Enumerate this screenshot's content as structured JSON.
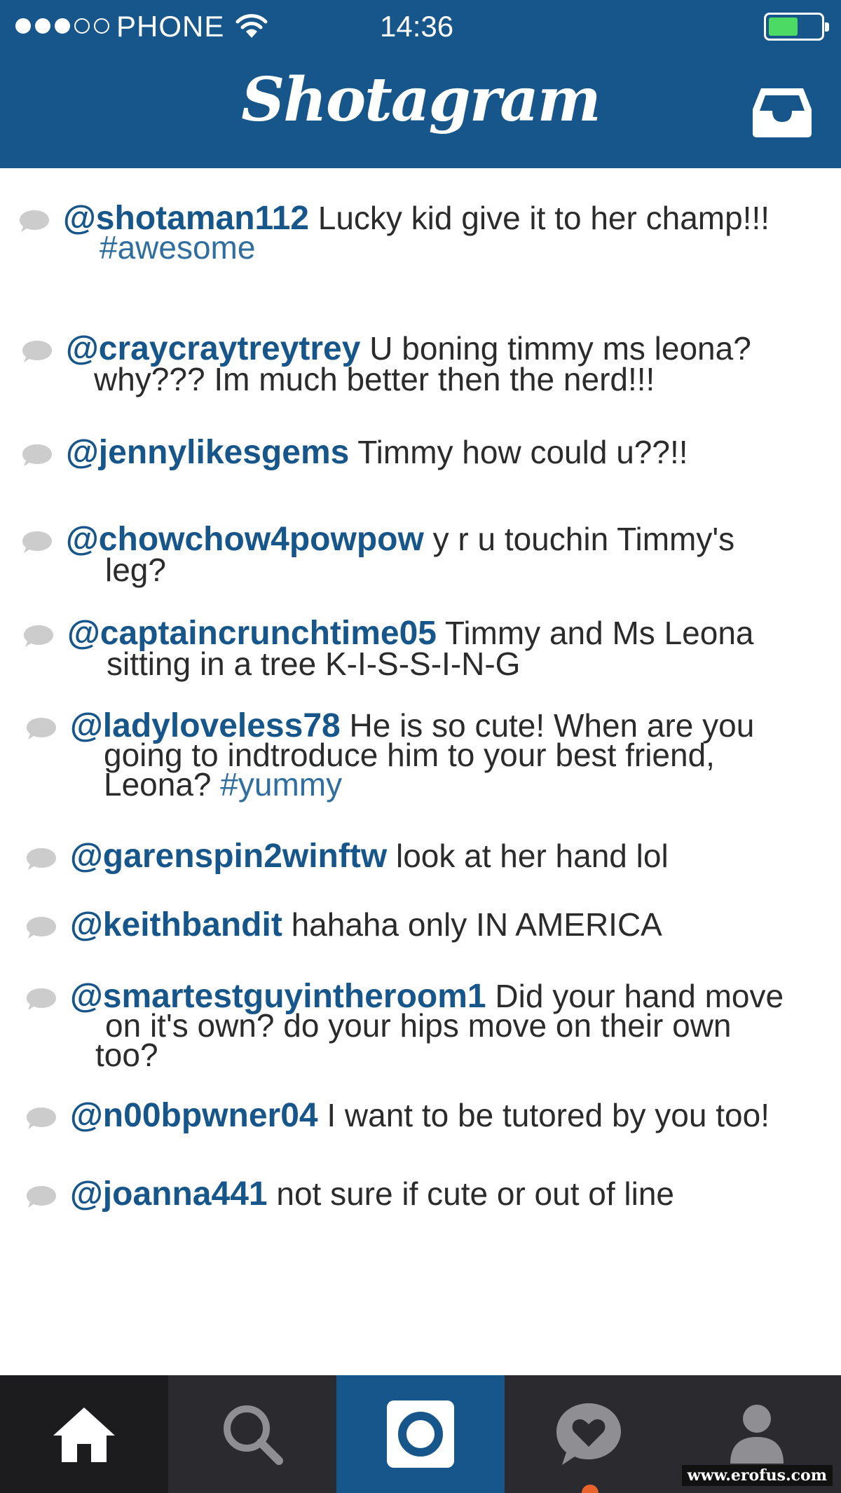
{
  "status_bar": {
    "carrier": "PHONE",
    "time": "14:36",
    "signal_filled": 3,
    "signal_total": 5,
    "battery_level": 0.55,
    "battery_color": "#4cd964"
  },
  "header": {
    "title": "Shotagram",
    "inbox_icon": "inbox-icon",
    "color": "#17568a"
  },
  "comments": [
    {
      "user": "@shotaman112",
      "line1": "Lucky kid give it to her champ!!!",
      "line2": "#awesome"
    },
    {
      "user": "@craycraytreytrey",
      "line1": "U boning timmy ms leona?",
      "line2": "why??? Im much better then the nerd!!!"
    },
    {
      "user": "@jennylikesgems",
      "line1": "Timmy how could u??!!"
    },
    {
      "user": "@chowchow4powpow",
      "line1": "y r u touchin Timmy's",
      "line2": "leg?"
    },
    {
      "user": "@captaincrunchtime05",
      "line1": "Timmy and Ms Leona",
      "line2": "sitting in a tree K-I-S-S-I-N-G"
    },
    {
      "user": "@ladyloveless78",
      "line1": "He is so cute! When are you",
      "line2": "going to indtroduce him to your best friend,",
      "line3_text": "Leona?",
      "line3_tag": "#yummy"
    },
    {
      "user": "@garenspin2winftw",
      "line1": "look at her hand lol"
    },
    {
      "user": "@keithbandit",
      "line1": "hahaha only IN AMERICA"
    },
    {
      "user": "@smartestguyintheroom1",
      "line1": "Did your hand move",
      "line2": "on it's own? do your hips move on their own",
      "line3": "too?"
    },
    {
      "user": "@n00bpwner04",
      "line1": "I want to be tutored by you too!"
    },
    {
      "user": "@joanna441",
      "line1": "not sure if cute or out of line"
    }
  ],
  "tabbar": {
    "tabs": [
      {
        "icon": "home-icon",
        "active": true
      },
      {
        "icon": "search-icon",
        "active": false
      },
      {
        "icon": "camera-icon",
        "active": false
      },
      {
        "icon": "activity-heart-icon",
        "active": false,
        "notification": true
      },
      {
        "icon": "profile-icon",
        "active": false
      }
    ],
    "notification_color": "#e8642c"
  },
  "watermark": "www.erofus.com"
}
